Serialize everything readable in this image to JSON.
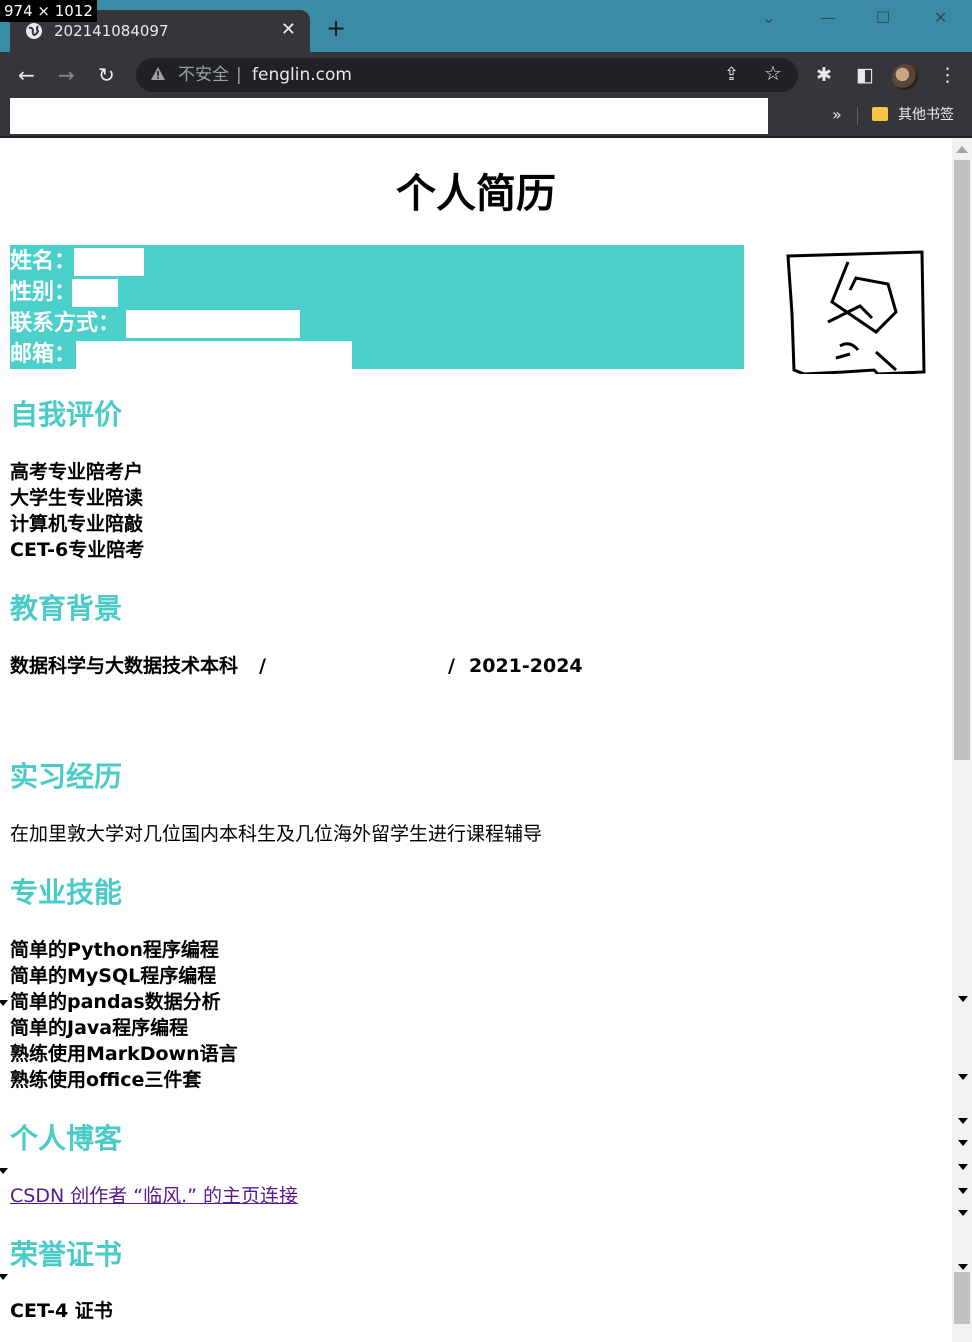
{
  "window": {
    "dimensions_label": "974 × 1012",
    "tab_title": "202141084097",
    "new_tab": "+",
    "tab_close": "✕",
    "minimize": "—",
    "maximize": "☐",
    "close": "✕",
    "dropdown": "⌄"
  },
  "toolbar": {
    "back": "←",
    "forward": "→",
    "reload": "↻",
    "security_label": "不安全",
    "separator": "|",
    "url": "fenglin.com",
    "share": "⇪",
    "star": "☆",
    "extensions": "✱",
    "sidepanel": "◧",
    "menu": "⋮"
  },
  "bookmarks": {
    "more": "»",
    "other_bookmarks": "其他书签"
  },
  "resume": {
    "title": "个人简历",
    "info": {
      "name_label": "姓名：",
      "gender_label": "性别：",
      "contact_label": "联系方式：",
      "email_label": "邮箱："
    },
    "self_evaluation": {
      "heading": "自我评价",
      "items": [
        "高考专业陪考户",
        "大学生专业陪读",
        "计算机专业陪敲",
        "CET-6专业陪考"
      ]
    },
    "education": {
      "heading": "教育背景",
      "major": "数据科学与大数据技术本科",
      "slash1": "/",
      "slash2": "/",
      "years": "2021-2024"
    },
    "internship": {
      "heading": "实习经历",
      "text": "在加里敦大学对几位国内本科生及几位海外留学生进行课程辅导"
    },
    "skills": {
      "heading": "专业技能",
      "items": [
        "简单的Python程序编程",
        "简单的MySQL程序编程",
        "简单的pandas数据分析",
        "简单的Java程序编程",
        "熟练使用MarkDown语言",
        "熟练使用office三件套"
      ]
    },
    "blog": {
      "heading": "个人博客",
      "link": "CSDN 创作者 “临风.” 的主页连接"
    },
    "honors": {
      "heading": "荣誉证书",
      "items": [
        "CET-4 证书"
      ]
    }
  },
  "colors": {
    "accent": "#4bcbc8",
    "info_bg": "#4bd0cc",
    "titlebar": "#3b8ba6",
    "chrome_dark": "#35363a",
    "link_visited": "#551a8b"
  }
}
